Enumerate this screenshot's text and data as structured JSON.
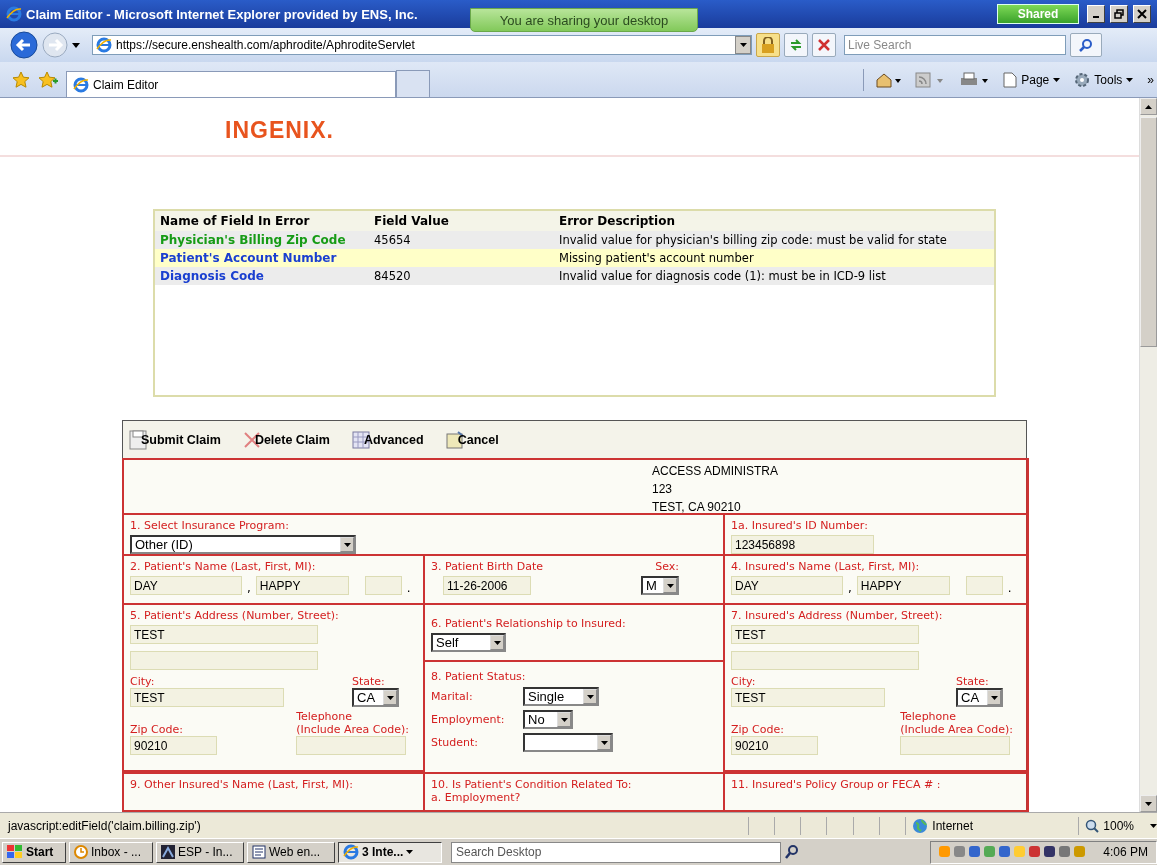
{
  "window": {
    "title": "Claim Editor - Microsoft Internet Explorer provided by ENS, Inc."
  },
  "sharing_banner": "You are sharing your desktop",
  "shared_button": "Shared",
  "address_bar": {
    "url": "https://secure.enshealth.com/aphrodite/AphroditeServlet"
  },
  "search": {
    "placeholder": "Live Search"
  },
  "tabs": [
    {
      "label": "Claim Editor",
      "selected": true
    }
  ],
  "command_bar": [
    {
      "label": "Page"
    },
    {
      "label": "Tools"
    },
    {
      "label": "»"
    }
  ],
  "page": {
    "logo": "INGENIX.",
    "errors": {
      "columns": [
        "Name of Field In Error",
        "Field Value",
        "Error Description"
      ],
      "rows": [
        {
          "field": "Physician's Billing Zip Code",
          "value": "45654",
          "description": "Invalid value for physician's billing zip code: must be valid for state",
          "color": "#169b16",
          "selected": false
        },
        {
          "field": "Patient's Account Number",
          "description": "Missing patient's account number",
          "color": "#1a3fd0",
          "selected": true
        },
        {
          "field": "Diagnosis Code",
          "value": "84520",
          "description": "Invalid value for diagnosis code (1): must be in ICD-9 list",
          "color": "#1a3fd0",
          "selected": false
        }
      ]
    },
    "toolbar": [
      {
        "label": "Submit Claim",
        "kind": "submit"
      },
      {
        "label": "Delete Claim",
        "kind": "delete"
      },
      {
        "label": "Advanced",
        "kind": "advanced"
      },
      {
        "label": "Cancel",
        "kind": "cancel"
      }
    ],
    "payer": [
      "ACCESS ADMINISTRA",
      "123",
      "TEST, CA 90210"
    ],
    "form": {
      "insurance_program": {
        "label": "1. Select Insurance Program:",
        "value": "Other (ID)"
      },
      "insured_id": {
        "label": "1a. Insured's ID Number:",
        "value": "123456898"
      },
      "patient_name": {
        "label": "2. Patient's Name (Last, First, MI):",
        "last": "DAY",
        "first": "HAPPY",
        "separators": [
          ",",
          "."
        ]
      },
      "birth_date": {
        "label": "3. Patient Birth Date",
        "value": "11-26-2006"
      },
      "sex": {
        "label": "Sex:",
        "value": "M"
      },
      "insured_name": {
        "label": "4. Insured's Name (Last, First, MI):",
        "last": "DAY",
        "first": "HAPPY",
        "separators": [
          ",",
          "."
        ]
      },
      "patient_address": {
        "label": "5. Patient's Address (Number, Street):",
        "street": "TEST",
        "city_label": "City:",
        "city": "TEST",
        "state_label": "State:",
        "state": "CA",
        "zip_label": "Zip Code:",
        "zip": "90210",
        "phone_label": "Telephone\n(Include Area Code):"
      },
      "relationship": {
        "label": "6. Patient's Relationship to Insured:",
        "value": "Self"
      },
      "patient_status": {
        "label": "8. Patient Status:",
        "marital_label": "Marital:",
        "marital": "Single",
        "employment_label": "Employment:",
        "employment": "No",
        "student_label": "Student:"
      },
      "insured_address": {
        "label": "7. Insured's Address (Number, Street):",
        "street": "TEST",
        "city_label": "City:",
        "city": "TEST",
        "state_label": "State:",
        "state": "CA",
        "zip_label": "Zip Code:",
        "zip": "90210",
        "phone_label": "Telephone\n(Include Area Code):"
      },
      "other_insured": {
        "label": "9. Other Insured's Name (Last, First, MI):"
      },
      "condition": {
        "label": "10. Is Patient's Condition Related To:",
        "sub_label": "a. Employment?"
      },
      "policy_group": {
        "label": "11. Insured's Policy Group or FECA # :"
      }
    }
  },
  "status_bar": {
    "text": "javascript:editField('claim.billing.zip')",
    "zone": "Internet",
    "zoom": "100%"
  },
  "taskbar": {
    "start": "Start",
    "buttons": [
      {
        "label": "Inbox - ...",
        "kind": "clock",
        "selected": false
      },
      {
        "label": "ESP - In...",
        "kind": "app",
        "selected": false
      },
      {
        "label": "Web en...",
        "kind": "doc",
        "selected": false
      },
      {
        "label": "3 Inte...",
        "kind": "ie",
        "selected": true
      }
    ],
    "search_placeholder": "Search Desktop",
    "clock": "4:06 PM"
  }
}
